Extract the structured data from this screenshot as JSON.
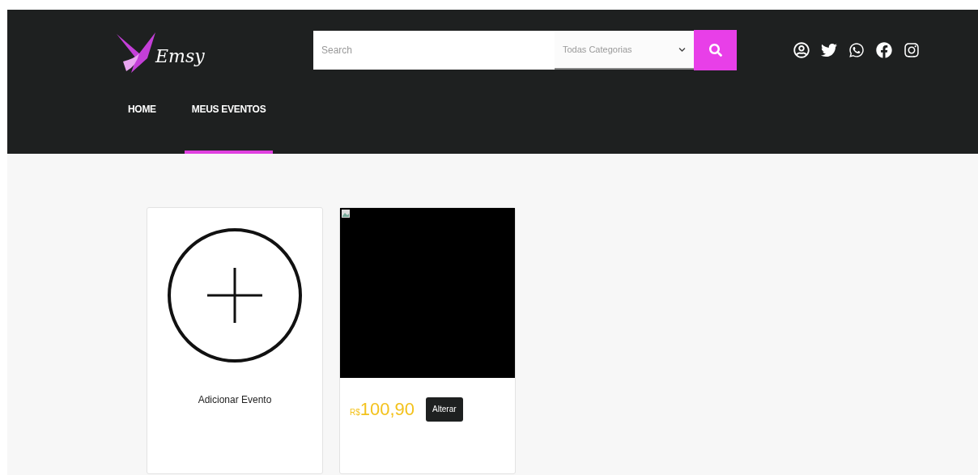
{
  "header": {
    "logo": "Emsy",
    "search": {
      "placeholder": "Search"
    },
    "category_select": {
      "value": "Todas Categorias"
    }
  },
  "nav": [
    {
      "label": "HOME",
      "selected": false
    },
    {
      "label": "MEUS EVENTOS",
      "selected": true
    }
  ],
  "add_card": {
    "label": "Adicionar Evento"
  },
  "events": [
    {
      "currency": "R$",
      "price": "100,90",
      "action": "Alterar"
    }
  ]
}
